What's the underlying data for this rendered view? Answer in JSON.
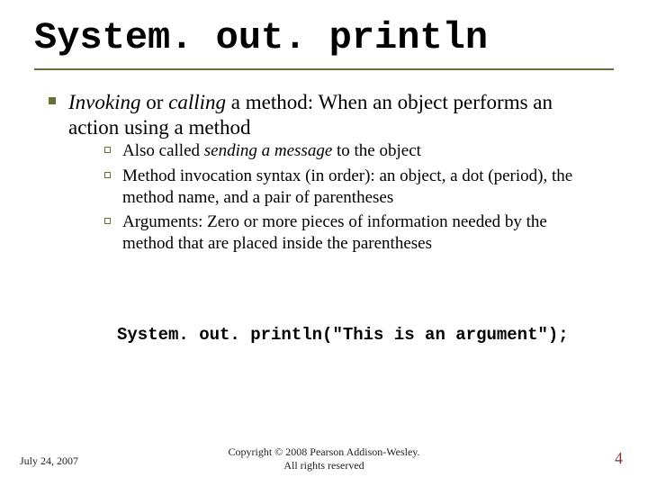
{
  "title": "System. out. println",
  "bullet1": {
    "prefix_italic": "Invoking",
    "mid1": " or ",
    "mid_italic": "calling",
    "tail": " a method:  When an object performs an action using a method",
    "sub": [
      {
        "pre": "Also called ",
        "em": "sending a message",
        "post": " to the object"
      },
      {
        "pre": "Method invocation syntax (in order):  an object, a dot (period), the method name, and a pair of parentheses",
        "em": "",
        "post": ""
      },
      {
        "pre": "Arguments:  Zero or more pieces of information needed by the method that are placed inside the parentheses",
        "em": "",
        "post": ""
      }
    ]
  },
  "code": "System. out. println(\"This is an argument\");",
  "footer": {
    "date": "July 24, 2007",
    "copyright_line1": "Copyright © 2008 Pearson Addison-Wesley.",
    "copyright_line2": "All rights reserved",
    "page": "4"
  }
}
